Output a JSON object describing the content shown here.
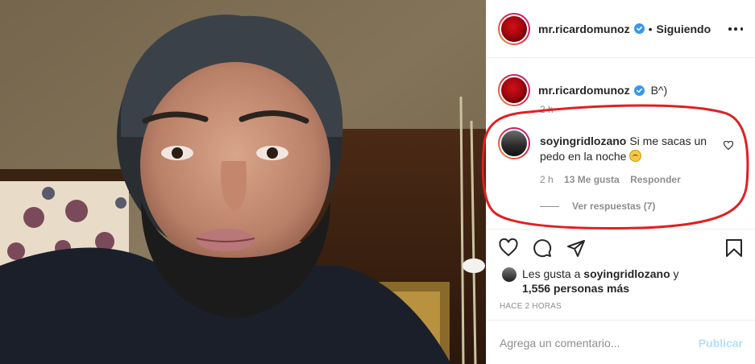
{
  "post": {
    "author": "mr.ricardomunoz",
    "follow_status": "Siguiendo",
    "separator": "•",
    "caption_text": "B^)",
    "caption_time": "2 h"
  },
  "comment": {
    "user": "soyingridlozano",
    "text": "Si me sacas un pedo en la noche",
    "time": "2 h",
    "likes": "13 Me gusta",
    "reply_label": "Responder",
    "view_replies": "Ver respuestas (7)"
  },
  "likes": {
    "prefix": "Les gusta a ",
    "user": "soyingridlozano",
    "connector": " y",
    "others": "1,556 personas más"
  },
  "posted_ago": "HACE 2 HORAS",
  "add_comment": {
    "placeholder": "Agrega un comentario...",
    "publish_label": "Publicar"
  },
  "icons": {
    "like": "heart-icon",
    "comment": "comment-icon",
    "share": "share-icon",
    "save": "bookmark-icon",
    "more": "more-options-icon",
    "verified": "verified-badge-icon"
  },
  "colors": {
    "verified": "#3897f0",
    "highlight": "#e02020",
    "muted": "#8e8e8e",
    "publish": "#b2dffc"
  }
}
